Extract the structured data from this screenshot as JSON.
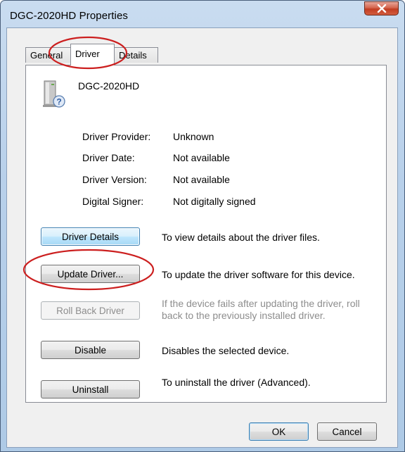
{
  "window": {
    "title": "DGC-2020HD Properties"
  },
  "tabs": [
    {
      "label": "General"
    },
    {
      "label": "Driver"
    },
    {
      "label": "Details"
    }
  ],
  "device": {
    "name": "DGC-2020HD",
    "icon": "device-unknown-icon"
  },
  "info": [
    {
      "label": "Driver Provider:",
      "value": "Unknown"
    },
    {
      "label": "Driver Date:",
      "value": "Not available"
    },
    {
      "label": "Driver Version:",
      "value": "Not available"
    },
    {
      "label": "Digital Signer:",
      "value": "Not digitally signed"
    }
  ],
  "actions": [
    {
      "label": "Driver Details",
      "description": "To view details about the driver files."
    },
    {
      "label": "Update Driver...",
      "description": "To update the driver software for this device."
    },
    {
      "label": "Roll Back Driver",
      "description": "If the device fails after updating the driver, roll back to the previously installed driver."
    },
    {
      "label": "Disable",
      "description": "Disables the selected device."
    },
    {
      "label": "Uninstall",
      "description": "To uninstall the driver (Advanced)."
    }
  ],
  "footer": {
    "ok_label": "OK",
    "cancel_label": "Cancel"
  },
  "colors": {
    "annotation": "#cc1f1f",
    "focus_border": "#3c7fb1"
  }
}
